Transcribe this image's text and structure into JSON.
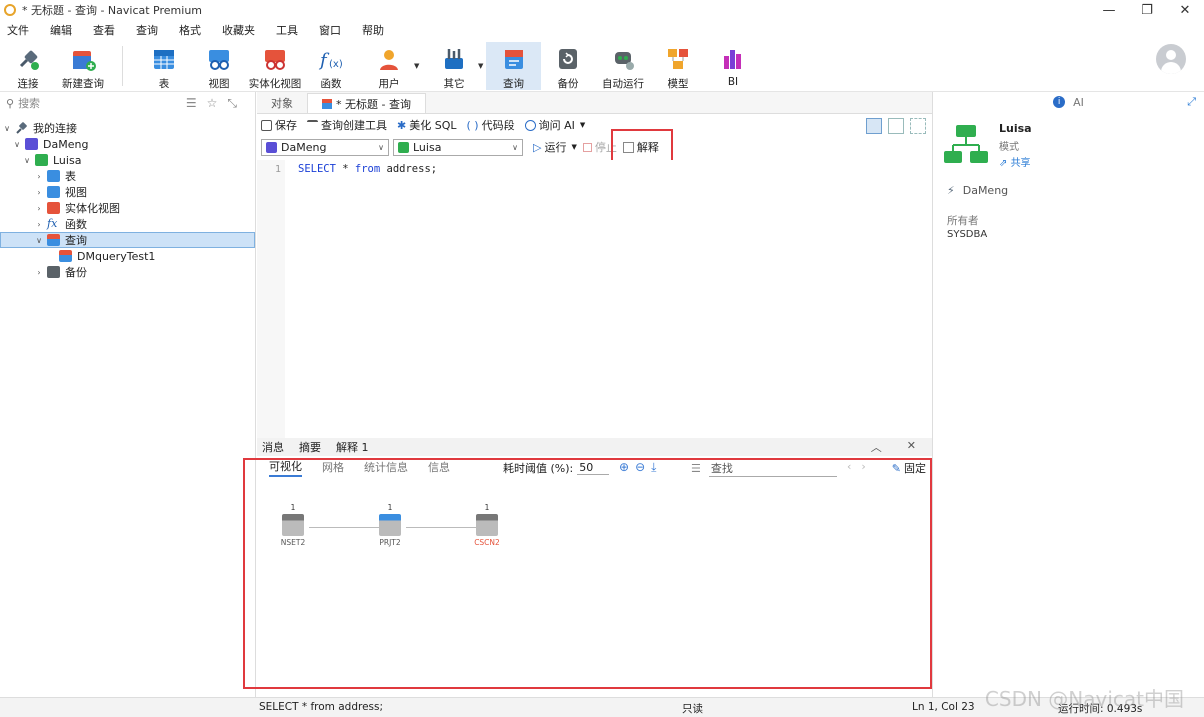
{
  "window": {
    "title": "* 无标题 - 查询 - Navicat Premium",
    "controls": [
      "—",
      "❐",
      "✕"
    ]
  },
  "menu": [
    "文件",
    "编辑",
    "查看",
    "查询",
    "格式",
    "收藏夹",
    "工具",
    "窗口",
    "帮助"
  ],
  "toolbar": [
    {
      "label": "连接",
      "icon": "plug-icon"
    },
    {
      "label": "新建查询",
      "icon": "new-query-icon"
    },
    {
      "label": "表",
      "icon": "table-icon"
    },
    {
      "label": "视图",
      "icon": "view-icon"
    },
    {
      "label": "实体化视图",
      "icon": "materialized-view-icon"
    },
    {
      "label": "函数",
      "icon": "function-icon"
    },
    {
      "label": "用户",
      "icon": "user-icon"
    },
    {
      "label": "其它",
      "icon": "other-icon"
    },
    {
      "label": "查询",
      "icon": "query-icon"
    },
    {
      "label": "备份",
      "icon": "backup-icon"
    },
    {
      "label": "自动运行",
      "icon": "auto-run-icon"
    },
    {
      "label": "模型",
      "icon": "model-icon"
    },
    {
      "label": "BI",
      "icon": "bi-icon"
    }
  ],
  "sidebar": {
    "search_placeholder": "搜索",
    "tree": [
      {
        "label": "我的连接",
        "level": 0
      },
      {
        "label": "DaMeng",
        "level": 1
      },
      {
        "label": "Luisa",
        "level": 2
      },
      {
        "label": "表",
        "level": 3
      },
      {
        "label": "视图",
        "level": 3
      },
      {
        "label": "实体化视图",
        "level": 3
      },
      {
        "label": "函数",
        "level": 3
      },
      {
        "label": "查询",
        "level": 3,
        "selected": true
      },
      {
        "label": "DMqueryTest1",
        "level": 4
      },
      {
        "label": "备份",
        "level": 3
      }
    ]
  },
  "editor": {
    "tabs": [
      "对象",
      "* 无标题 - 查询"
    ],
    "actions": {
      "save": "保存",
      "builder": "查询创建工具",
      "beautify": "美化 SQL",
      "snippet": "代码段",
      "ask_ai": "询问 AI"
    },
    "connection": "DaMeng",
    "schema": "Luisa",
    "run": "运行",
    "stop": "停止",
    "explain": "解释",
    "line_number": "1",
    "sql_keyword1": "SELECT",
    "sql_mid": " * ",
    "sql_keyword2": "from",
    "sql_rest": " address;"
  },
  "results": {
    "tabs": [
      "消息",
      "摘要",
      "解释 1"
    ],
    "subtabs": [
      "可视化",
      "网格",
      "统计信息",
      "信息"
    ],
    "threshold_label": "耗时阈值 (%):",
    "threshold_value": "50",
    "find_placeholder": "查找",
    "pin_label": "固定",
    "plan_nodes": [
      {
        "name": "NSET2",
        "count": "1"
      },
      {
        "name": "PRJT2",
        "count": "1"
      },
      {
        "name": "CSCN2",
        "count": "1"
      }
    ]
  },
  "right_panel": {
    "tab_ai": "AI",
    "schema_name": "Luisa",
    "schema_type": "模式",
    "share": "共享",
    "connection": "DaMeng",
    "owner_label": "所有者",
    "owner_value": "SYSDBA"
  },
  "status": {
    "sql": "SELECT * from address;",
    "readonly": "只读",
    "position": "Ln 1, Col 23",
    "runtime": "运行时间: 0.493s"
  },
  "watermark": "CSDN @Navicat中国"
}
